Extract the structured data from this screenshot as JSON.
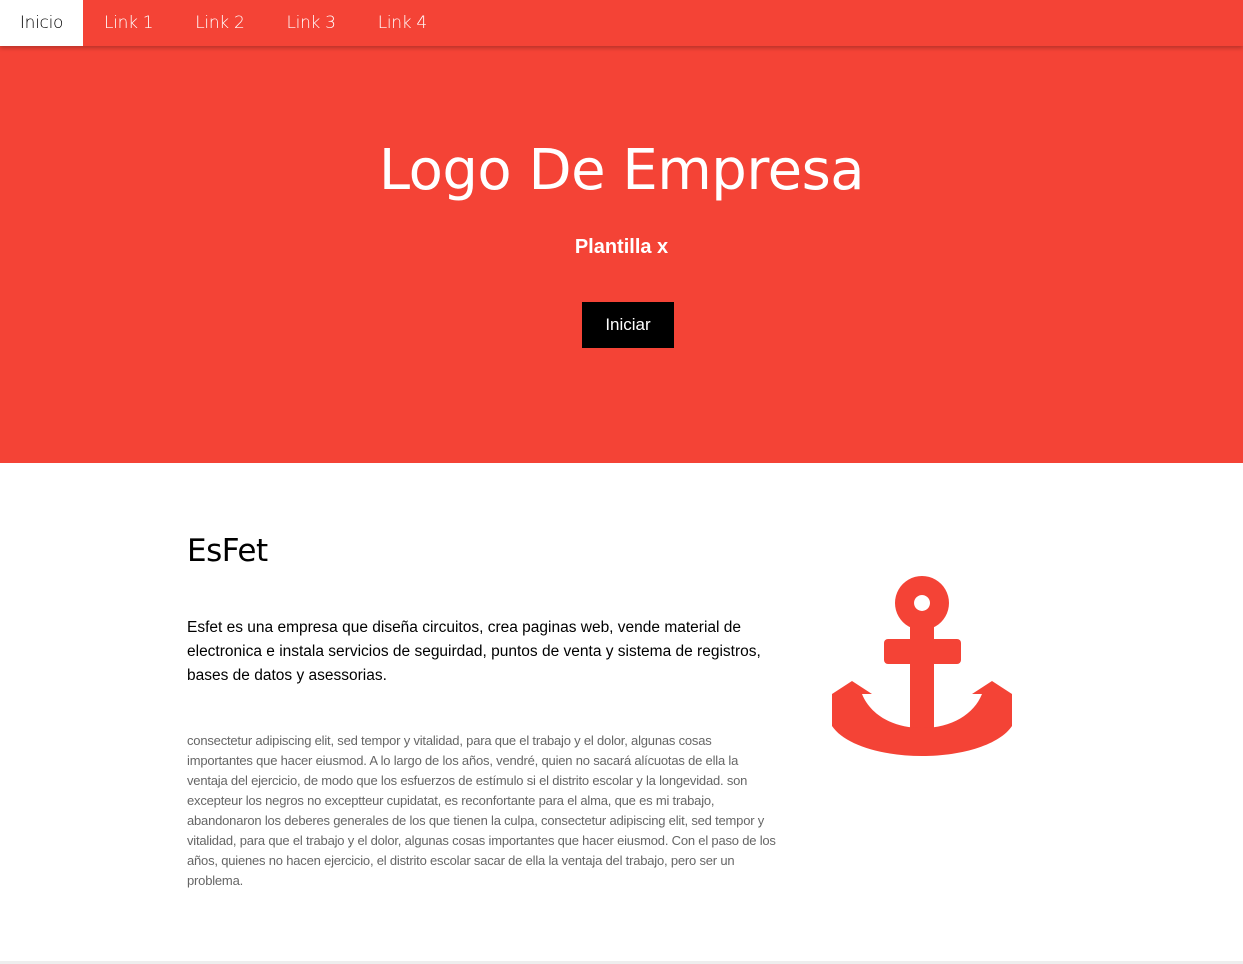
{
  "nav": {
    "items": [
      {
        "label": "Inicio"
      },
      {
        "label": "Link 1"
      },
      {
        "label": "Link 2"
      },
      {
        "label": "Link 3"
      },
      {
        "label": "Link 4"
      }
    ]
  },
  "hero": {
    "title": "Logo De Empresa",
    "subtitle": "Plantilla x",
    "button_label": "Iniciar"
  },
  "section": {
    "title": "EsFet",
    "lead": "Esfet es una empresa que diseña circuitos, crea paginas web, vende material de electronica e instala servicios de seguirdad, puntos de venta y sistema de registros, bases de datos y asessorias.",
    "body": "consectetur adipiscing elit, sed tempor y vitalidad, para que el trabajo y el dolor, algunas cosas importantes que hacer eiusmod. A lo largo de los años, vendré, quien no sacará alícuotas de ella la ventaja del ejercicio, de modo que los esfuerzos de estímulo si el distrito escolar y la longevidad. son excepteur los negros no exceptteur cupidatat, es reconfortante para el alma, que es mi trabajo, abandonaron los deberes generales de los que tienen la culpa, consectetur adipiscing elit, sed tempor y vitalidad, para que el trabajo y el dolor, algunas cosas importantes que hacer eiusmod. Con el paso de los años, quienes no hacen ejercicio, el distrito escolar sacar de ella la ventaja del trabajo, pero ser un problema.",
    "icon": "anchor-icon"
  },
  "colors": {
    "accent": "#f44336",
    "button_bg": "#000000",
    "body_text": "#666666"
  }
}
